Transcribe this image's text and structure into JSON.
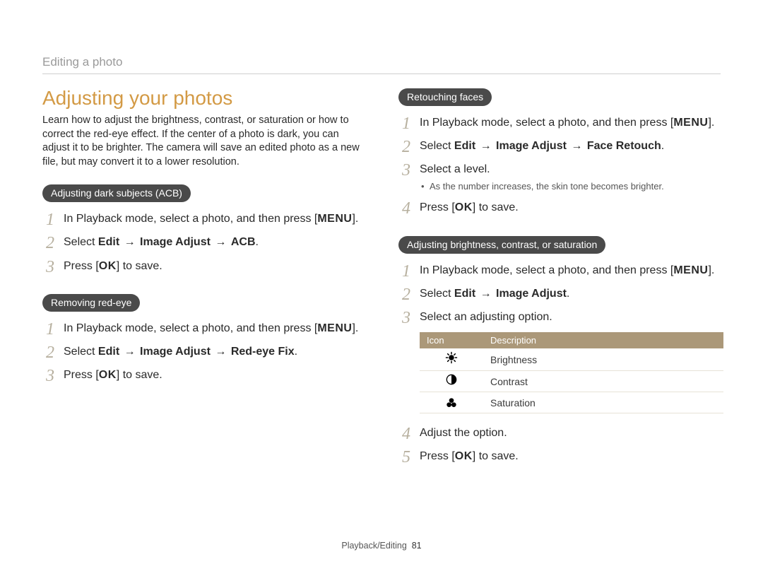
{
  "header": "Editing a photo",
  "title": "Adjusting your photos",
  "intro": "Learn how to adjust the brightness, contrast, or saturation or how to correct the red-eye effect. If the center of a photo is dark, you can adjust it to be brighter. The camera will save an edited photo as a new file, but may convert it to a lower resolution.",
  "labels": {
    "menu": "MENU",
    "ok": "OK",
    "arrow": "→",
    "select": "Select ",
    "edit": "Edit",
    "image_adjust": "Image Adjust",
    "acb": "ACB",
    "redeye": "Red-eye Fix",
    "face_retouch": "Face Retouch",
    "period": ".",
    "open_bracket": "[",
    "close_bracket": "]",
    "press": "Press ",
    "to_save": " to save."
  },
  "sections": {
    "acb": {
      "pill": "Adjusting dark subjects (ACB)",
      "step1a": "In Playback mode, select a photo, and then press "
    },
    "redeye": {
      "pill": "Removing red-eye",
      "step1a": "In Playback mode, select a photo, and then press "
    },
    "faces": {
      "pill": "Retouching faces",
      "step1a": "In Playback mode, select a photo, and then press ",
      "step3": "Select a level.",
      "bullet1": "As the number increases, the skin tone becomes brighter."
    },
    "bcs": {
      "pill": "Adjusting brightness, contrast, or saturation",
      "step1a": "In Playback mode, select a photo, and then press ",
      "step3": "Select an adjusting option.",
      "step4": "Adjust the option."
    }
  },
  "table": {
    "head_icon": "Icon",
    "head_desc": "Description",
    "rows": {
      "brightness": "Brightness",
      "contrast": "Contrast",
      "saturation": "Saturation"
    }
  },
  "footer": {
    "section": "Playback/Editing",
    "page": "81"
  }
}
